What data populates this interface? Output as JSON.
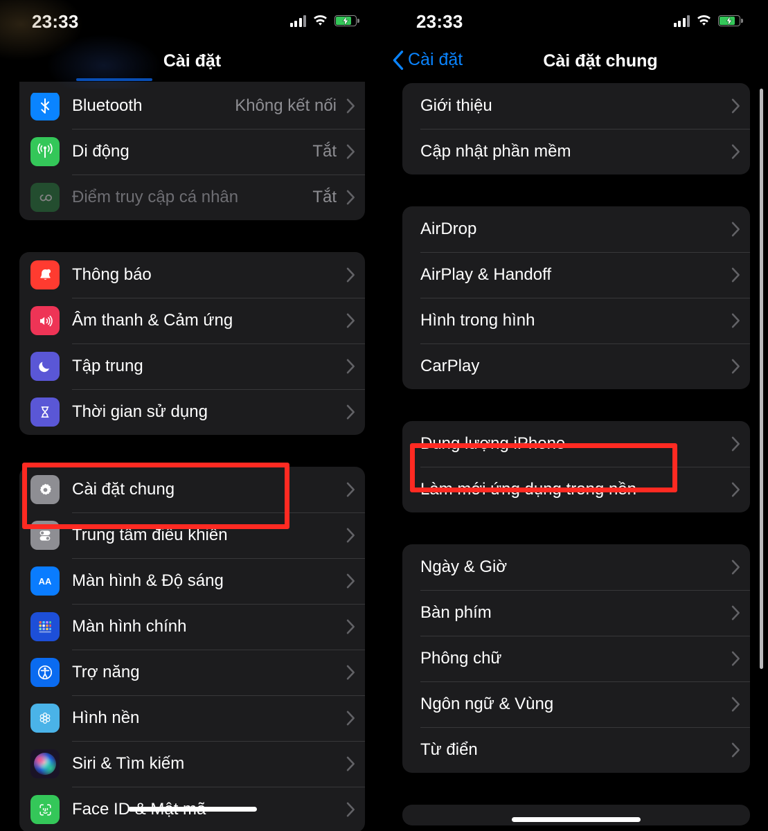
{
  "status_bar": {
    "time": "23:33",
    "cellular_icon": "cellular-bars-icon",
    "wifi_icon": "wifi-icon",
    "battery_icon": "battery-charging-icon"
  },
  "colors": {
    "accent_blue": "#0a84ff",
    "highlight_red": "#ff2a22",
    "card_bg": "#1c1c1e",
    "separator": "#38383a",
    "secondary_text": "#8e8e93"
  },
  "left_panel": {
    "nav": {
      "title": "Cài đặt"
    },
    "groups": [
      {
        "name": "connectivity",
        "rows": [
          {
            "label": "Bluetooth",
            "value": "Không kết nối",
            "icon": "bluetooth-icon",
            "icon_color": "#0a84ff",
            "dim": false
          },
          {
            "label": "Di động",
            "value": "Tắt",
            "icon": "cellular-icon",
            "icon_color": "#34c759",
            "dim": false
          },
          {
            "label": "Điểm truy cập cá nhân",
            "value": "Tắt",
            "icon": "personal-hotspot-icon",
            "icon_color": "#2e8b45",
            "dim": true
          }
        ]
      },
      {
        "name": "notifications",
        "rows": [
          {
            "label": "Thông báo",
            "value": "",
            "icon": "notifications-bell-icon",
            "icon_color": "#ff3b30",
            "dim": false
          },
          {
            "label": "Âm thanh & Cảm ứng",
            "value": "",
            "icon": "sound-haptics-icon",
            "icon_color": "#ee3456",
            "dim": false
          },
          {
            "label": "Tập trung",
            "value": "",
            "icon": "focus-moon-icon",
            "icon_color": "#5a57d6",
            "dim": false
          },
          {
            "label": "Thời gian sử dụng",
            "value": "",
            "icon": "screen-time-hourglass-icon",
            "icon_color": "#5a57d6",
            "dim": false
          }
        ]
      },
      {
        "name": "system",
        "rows": [
          {
            "label": "Cài đặt chung",
            "value": "",
            "icon": "gear-icon",
            "icon_color": "#8e8e93",
            "dim": false,
            "highlighted": true
          },
          {
            "label": "Trung tâm điều khiển",
            "value": "",
            "icon": "control-center-icon",
            "icon_color": "#8e8e93",
            "dim": false
          },
          {
            "label": "Màn hình & Độ sáng",
            "value": "",
            "icon": "display-brightness-icon",
            "icon_color": "#0a7cff",
            "dim": false
          },
          {
            "label": "Màn hình chính",
            "value": "",
            "icon": "home-screen-icon",
            "icon_color": "#1d4fd8",
            "dim": false
          },
          {
            "label": "Trợ năng",
            "value": "",
            "icon": "accessibility-icon",
            "icon_color": "#0a6bf0",
            "dim": false
          },
          {
            "label": "Hình nền",
            "value": "",
            "icon": "wallpaper-icon",
            "icon_color": "#4ab3e8",
            "dim": false
          },
          {
            "label": "Siri & Tìm kiếm",
            "value": "",
            "icon": "siri-icon",
            "icon_color": "#3a2a4a",
            "dim": false
          },
          {
            "label": "Face ID & Mật mã",
            "value": "",
            "icon": "face-id-icon",
            "icon_color": "#34c759",
            "dim": false
          }
        ]
      }
    ]
  },
  "right_panel": {
    "nav": {
      "back_label": "Cài đặt",
      "title": "Cài đặt chung"
    },
    "groups": [
      {
        "name": "about",
        "rows": [
          {
            "label": "Giới thiệu"
          },
          {
            "label": "Cập nhật phần mềm"
          }
        ]
      },
      {
        "name": "sharing",
        "rows": [
          {
            "label": "AirDrop"
          },
          {
            "label": "AirPlay & Handoff"
          },
          {
            "label": "Hình trong hình"
          },
          {
            "label": "CarPlay"
          }
        ]
      },
      {
        "name": "storage",
        "rows": [
          {
            "label": "Dung lượng iPhone",
            "highlighted": true
          },
          {
            "label": "Làm mới ứng dụng trong nền"
          }
        ]
      },
      {
        "name": "localization",
        "rows": [
          {
            "label": "Ngày & Giờ"
          },
          {
            "label": "Bàn phím"
          },
          {
            "label": "Phông chữ"
          },
          {
            "label": "Ngôn ngữ & Vùng"
          },
          {
            "label": "Từ điển"
          }
        ]
      }
    ]
  }
}
